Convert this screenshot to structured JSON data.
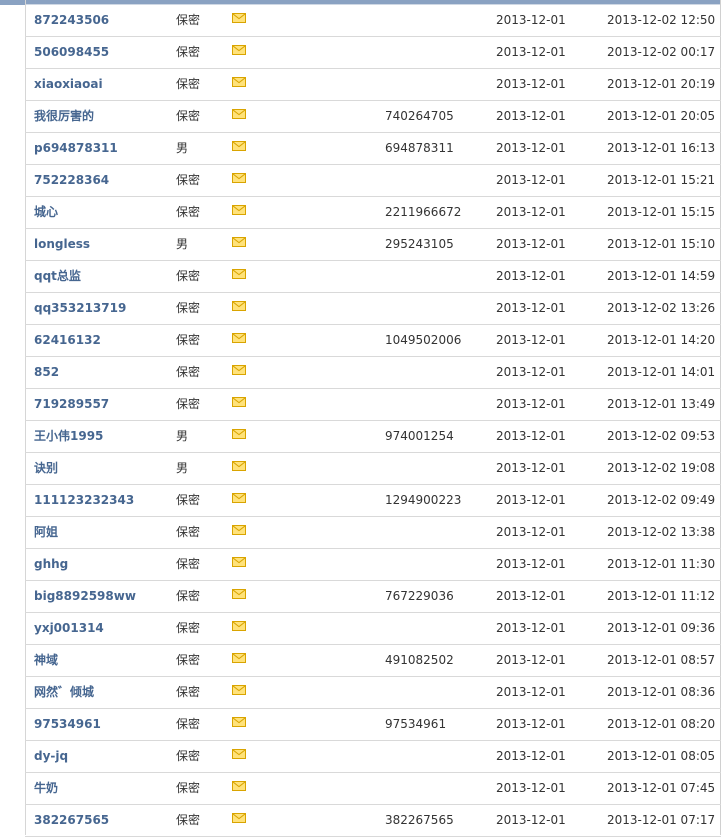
{
  "members": [
    {
      "name": "872243506",
      "gender": "保密",
      "qq": "",
      "reg_date": "2013-12-01",
      "last_login": "2013-12-02 12:50"
    },
    {
      "name": "506098455",
      "gender": "保密",
      "qq": "",
      "reg_date": "2013-12-01",
      "last_login": "2013-12-02 00:17"
    },
    {
      "name": "xiaoxiaoai",
      "gender": "保密",
      "qq": "",
      "reg_date": "2013-12-01",
      "last_login": "2013-12-01 20:19"
    },
    {
      "name": "我很厉害的",
      "gender": "保密",
      "qq": "740264705",
      "reg_date": "2013-12-01",
      "last_login": "2013-12-01 20:05"
    },
    {
      "name": "p694878311",
      "gender": "男",
      "qq": "694878311",
      "reg_date": "2013-12-01",
      "last_login": "2013-12-01 16:13"
    },
    {
      "name": "752228364",
      "gender": "保密",
      "qq": "",
      "reg_date": "2013-12-01",
      "last_login": "2013-12-01 15:21"
    },
    {
      "name": "城心",
      "gender": "保密",
      "qq": "2211966672",
      "reg_date": "2013-12-01",
      "last_login": "2013-12-01 15:15"
    },
    {
      "name": "longless",
      "gender": "男",
      "qq": "295243105",
      "reg_date": "2013-12-01",
      "last_login": "2013-12-01 15:10"
    },
    {
      "name": "qqt总监",
      "gender": "保密",
      "qq": "",
      "reg_date": "2013-12-01",
      "last_login": "2013-12-01 14:59"
    },
    {
      "name": "qq353213719",
      "gender": "保密",
      "qq": "",
      "reg_date": "2013-12-01",
      "last_login": "2013-12-02 13:26"
    },
    {
      "name": "62416132",
      "gender": "保密",
      "qq": "1049502006",
      "reg_date": "2013-12-01",
      "last_login": "2013-12-01 14:20"
    },
    {
      "name": "852",
      "gender": "保密",
      "qq": "",
      "reg_date": "2013-12-01",
      "last_login": "2013-12-01 14:01"
    },
    {
      "name": "719289557",
      "gender": "保密",
      "qq": "",
      "reg_date": "2013-12-01",
      "last_login": "2013-12-01 13:49"
    },
    {
      "name": "王小伟1995",
      "gender": "男",
      "qq": "974001254",
      "reg_date": "2013-12-01",
      "last_login": "2013-12-02 09:53"
    },
    {
      "name": "诀别",
      "gender": "男",
      "qq": "",
      "reg_date": "2013-12-01",
      "last_login": "2013-12-02 19:08"
    },
    {
      "name": "111123232343",
      "gender": "保密",
      "qq": "1294900223",
      "reg_date": "2013-12-01",
      "last_login": "2013-12-02 09:49"
    },
    {
      "name": "阿姐",
      "gender": "保密",
      "qq": "",
      "reg_date": "2013-12-01",
      "last_login": "2013-12-02 13:38"
    },
    {
      "name": "ghhg",
      "gender": "保密",
      "qq": "",
      "reg_date": "2013-12-01",
      "last_login": "2013-12-01 11:30"
    },
    {
      "name": "big8892598ww",
      "gender": "保密",
      "qq": "767229036",
      "reg_date": "2013-12-01",
      "last_login": "2013-12-01 11:12"
    },
    {
      "name": "yxj001314",
      "gender": "保密",
      "qq": "",
      "reg_date": "2013-12-01",
      "last_login": "2013-12-01 09:36"
    },
    {
      "name": "神域",
      "gender": "保密",
      "qq": "491082502",
      "reg_date": "2013-12-01",
      "last_login": "2013-12-01 08:57"
    },
    {
      "name": "网然゛倾城",
      "gender": "保密",
      "qq": "",
      "reg_date": "2013-12-01",
      "last_login": "2013-12-01 08:36"
    },
    {
      "name": "97534961",
      "gender": "保密",
      "qq": "97534961",
      "reg_date": "2013-12-01",
      "last_login": "2013-12-01 08:20"
    },
    {
      "name": "dy-jq",
      "gender": "保密",
      "qq": "",
      "reg_date": "2013-12-01",
      "last_login": "2013-12-01 08:05"
    },
    {
      "name": "牛奶",
      "gender": "保密",
      "qq": "",
      "reg_date": "2013-12-01",
      "last_login": "2013-12-01 07:45"
    },
    {
      "name": "382267565",
      "gender": "保密",
      "qq": "382267565",
      "reg_date": "2013-12-01",
      "last_login": "2013-12-01 07:17"
    }
  ],
  "icons": {
    "mail": "envelope-icon"
  },
  "colors": {
    "username": "#466690",
    "envelope": "#f2c200",
    "divider": "#d9d9d9"
  }
}
